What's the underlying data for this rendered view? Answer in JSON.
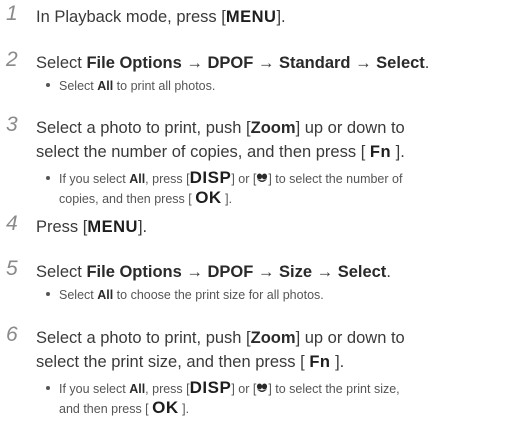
{
  "steps": [
    {
      "number": "1",
      "segments": [
        "In Playback mode, press [",
        "MENU",
        "]."
      ]
    },
    {
      "number": "2",
      "segments": [
        "Select ",
        "File Options",
        " → ",
        "DPOF",
        " → ",
        "Standard",
        " → ",
        "Select",
        "."
      ],
      "bullet": [
        "Select ",
        "All",
        " to print all photos."
      ]
    },
    {
      "number": "3",
      "line1": [
        "Select a photo to print, push [",
        "Zoom",
        "] up or down to"
      ],
      "line2": [
        "select the number of copies, and then press [ ",
        "Fn",
        " ]."
      ],
      "bullet1": [
        "If you select ",
        "All",
        ", press [",
        "DISP",
        "] or [",
        "] to select the number of"
      ],
      "bullet2": [
        "copies, and then press [ ",
        "OK",
        " ]."
      ]
    },
    {
      "number": "4",
      "segments": [
        "Press [",
        "MENU",
        "]."
      ]
    },
    {
      "number": "5",
      "segments": [
        "Select ",
        "File Options",
        " → ",
        "DPOF",
        " → ",
        "Size",
        " → ",
        "Select",
        "."
      ],
      "bullet": [
        "Select ",
        "All",
        " to choose the print size for all photos."
      ]
    },
    {
      "number": "6",
      "line1": [
        "Select a photo to print, push [",
        "Zoom",
        "] up or down to"
      ],
      "line2": [
        "select the print size, and then press [ ",
        "Fn",
        " ]."
      ],
      "bullet1": [
        "If you select ",
        "All",
        ", press [",
        "DISP",
        "] or [",
        "] to select the print size,"
      ],
      "bullet2": [
        "and then press [ ",
        "OK",
        " ]."
      ]
    }
  ],
  "icons": {
    "macro": "macro-flower-icon"
  }
}
